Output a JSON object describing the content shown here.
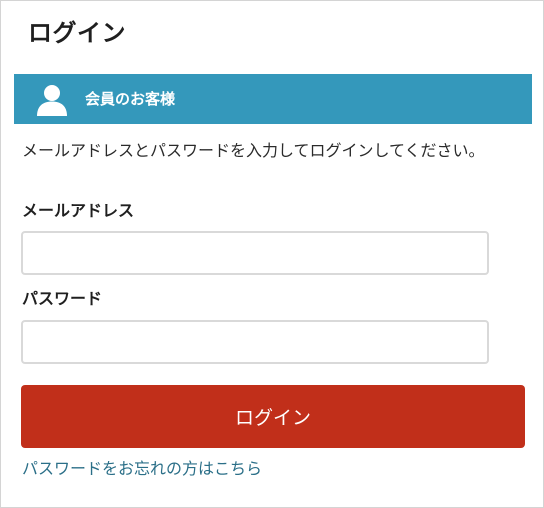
{
  "page": {
    "title": "ログイン"
  },
  "member_section": {
    "label": "会員のお客様",
    "icon": "user-icon",
    "header_color": "#3498bb"
  },
  "instructions": "メールアドレスとパスワードを入力してログインしてください。",
  "form": {
    "email_label": "メールアドレス",
    "email_value": "",
    "password_label": "パスワード",
    "password_value": "",
    "login_button_label": "ログイン",
    "login_button_color": "#c12f1a"
  },
  "forgot_password_link": "パスワードをお忘れの方はこちら"
}
